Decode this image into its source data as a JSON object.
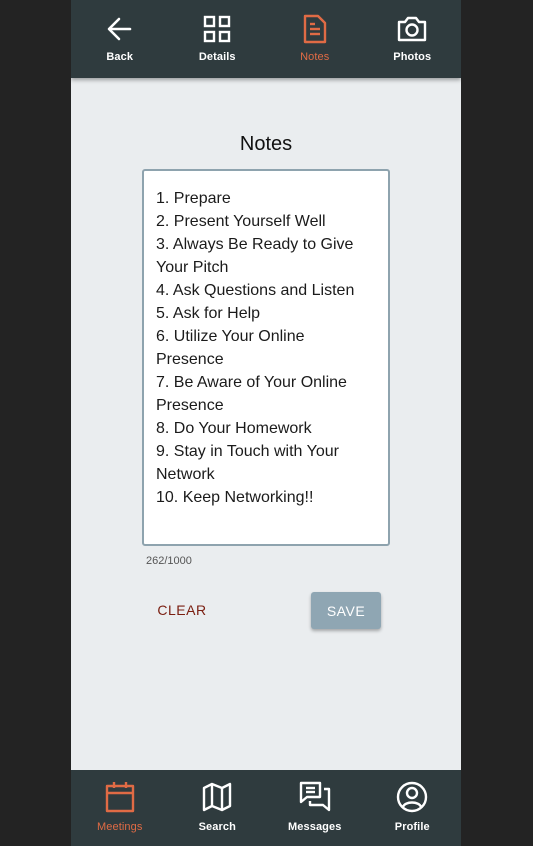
{
  "top_nav": {
    "items": [
      {
        "label": "Back",
        "icon": "arrow-left-icon"
      },
      {
        "label": "Details",
        "icon": "grid-icon"
      },
      {
        "label": "Notes",
        "icon": "note-icon",
        "active": true
      },
      {
        "label": "Photos",
        "icon": "camera-icon"
      }
    ]
  },
  "page": {
    "title": "Notes",
    "notes_value": "1. Prepare\n2. Present Yourself Well\n3. Always Be Ready to Give Your Pitch\n4. Ask Questions and Listen\n5. Ask for Help\n6. Utilize Your Online Presence\n7. Be Aware of Your Online Presence\n8. Do Your Homework\n9. Stay in Touch with Your Network\n10. Keep Networking!!",
    "char_count": "262/1000",
    "clear_label": "CLEAR",
    "save_label": "SAVE"
  },
  "bottom_nav": {
    "items": [
      {
        "label": "Meetings",
        "icon": "calendar-icon",
        "active": true
      },
      {
        "label": "Search",
        "icon": "map-icon"
      },
      {
        "label": "Messages",
        "icon": "chat-icon"
      },
      {
        "label": "Profile",
        "icon": "profile-icon"
      }
    ]
  },
  "colors": {
    "bar_bg": "#2f3b3e",
    "accent": "#e06b45",
    "page_bg": "#eaedef",
    "save_bg": "#8fa6b3",
    "clear_text": "#7a1e10"
  }
}
